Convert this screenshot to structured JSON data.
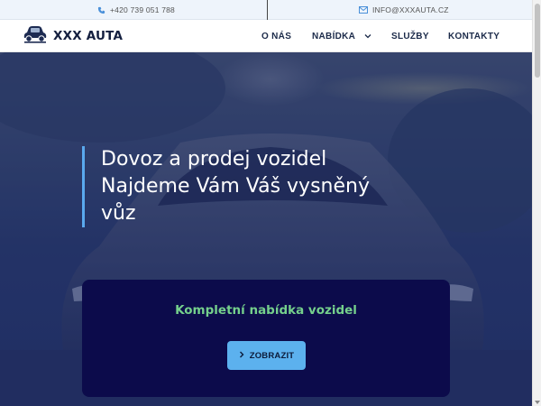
{
  "topbar": {
    "phone": "+420 739 051 788",
    "email": "INFO@XXXAUTA.CZ"
  },
  "logo": {
    "text": "XXX AUTA"
  },
  "nav": {
    "items": [
      {
        "label": "O NÁS"
      },
      {
        "label": "NABÍDKA"
      },
      {
        "label": "SLUŽBY"
      },
      {
        "label": "KONTAKTY"
      }
    ]
  },
  "hero": {
    "headline": [
      "Dovoz a prodej vozidel",
      "Najdeme Vám Váš vysněný",
      "vůz"
    ],
    "card_title": "Kompletní nabídka vozidel",
    "cta_label": "ZOBRAZIT"
  },
  "colors": {
    "accent": "#5cb1ee",
    "card_bg": "#0c0b4b",
    "card_title": "#75d08c",
    "brand_dark": "#141f3f"
  },
  "icons": [
    "phone-icon",
    "mail-icon",
    "car-logo-icon",
    "chevron-down-icon",
    "chevron-right-icon"
  ]
}
